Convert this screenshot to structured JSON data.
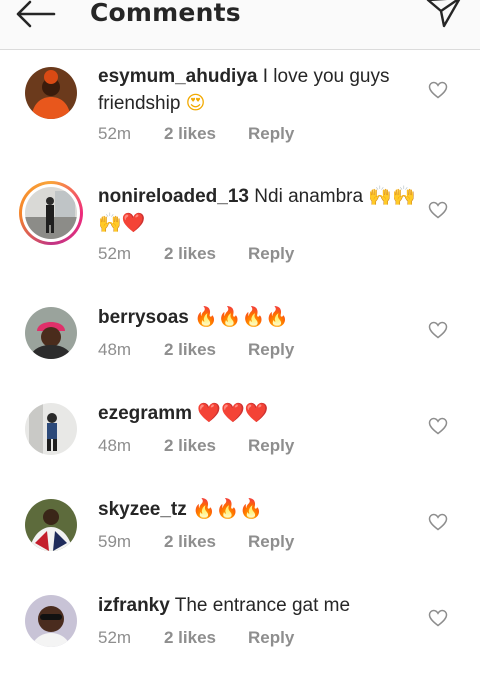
{
  "header": {
    "title": "Comments"
  },
  "comments": [
    {
      "username": "esymum_ahudiya",
      "text": " I love you guys friendship ",
      "emoji": "😍",
      "time": "52m",
      "likes": "2 likes",
      "reply": "Reply",
      "story_ring": false
    },
    {
      "username": "nonireloaded_13",
      "text": " Ndi anambra ",
      "emoji": "🙌🙌🙌❤️",
      "time": "52m",
      "likes": "2 likes",
      "reply": "Reply",
      "story_ring": true
    },
    {
      "username": "berrysoas",
      "text": " ",
      "emoji": "🔥🔥🔥🔥",
      "time": "48m",
      "likes": "2 likes",
      "reply": "Reply",
      "story_ring": false
    },
    {
      "username": "ezegramm",
      "text": " ",
      "emoji": "❤️❤️❤️",
      "time": "48m",
      "likes": "2 likes",
      "reply": "Reply",
      "story_ring": false
    },
    {
      "username": "skyzee_tz",
      "text": " ",
      "emoji": "🔥🔥🔥",
      "time": "59m",
      "likes": "2 likes",
      "reply": "Reply",
      "story_ring": false
    },
    {
      "username": "izfranky",
      "text": " The entrance gat me",
      "emoji": "",
      "time": "52m",
      "likes": "2 likes",
      "reply": "Reply",
      "story_ring": false
    }
  ],
  "colors": {
    "text": "#262626",
    "secondary": "#8e8e8e",
    "divider": "#dbdbdb",
    "story_ring": "#ee2a7b"
  }
}
